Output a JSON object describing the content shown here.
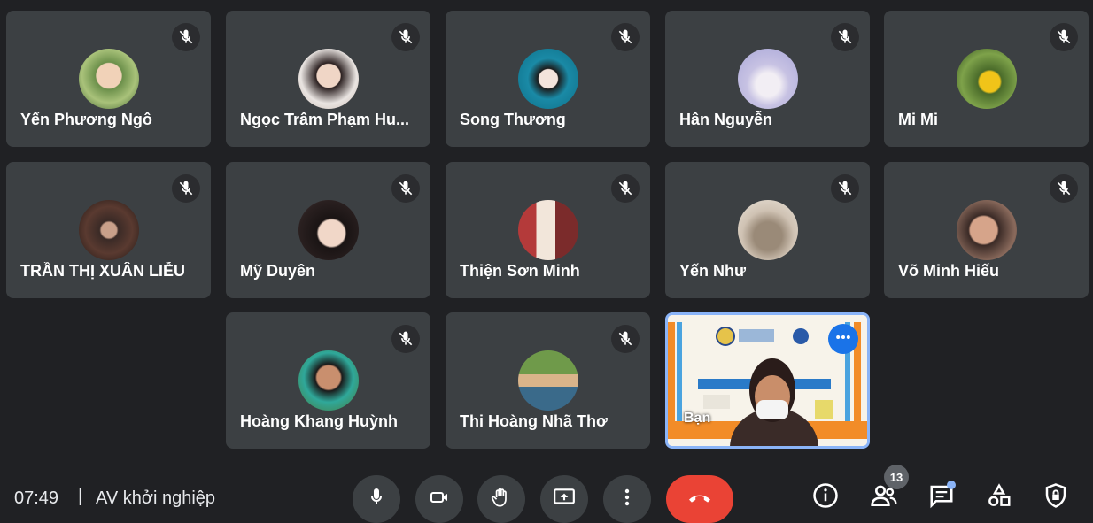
{
  "participants": [
    {
      "name": "Yến Phương Ngô"
    },
    {
      "name": "Ngọc Trâm Phạm Hu..."
    },
    {
      "name": "Song Thương"
    },
    {
      "name": "Hân Nguyễn"
    },
    {
      "name": "Mi Mi"
    },
    {
      "name": "TRẦN THỊ XUÂN LIỄU"
    },
    {
      "name": "Mỹ Duyên"
    },
    {
      "name": "Thiện Sơn Minh"
    },
    {
      "name": "Yến Như"
    },
    {
      "name": "Võ Minh Hiếu"
    },
    {
      "name": "Hoàng Khang Huỳnh"
    },
    {
      "name": "Thi Hoàng Nhã Thơ"
    }
  ],
  "self_tile": {
    "label": "Bạn"
  },
  "bottom_bar": {
    "time": "07:49",
    "separator": "|",
    "meeting_name": "AV khởi nghiệp",
    "people_count": "13"
  },
  "icons": {
    "mute": "mic-off-icon",
    "more": "more-vert-icon"
  },
  "colors": {
    "background": "#202124",
    "tile": "#3c4043",
    "end_call": "#ea4335",
    "accent": "#8ab4f8"
  }
}
